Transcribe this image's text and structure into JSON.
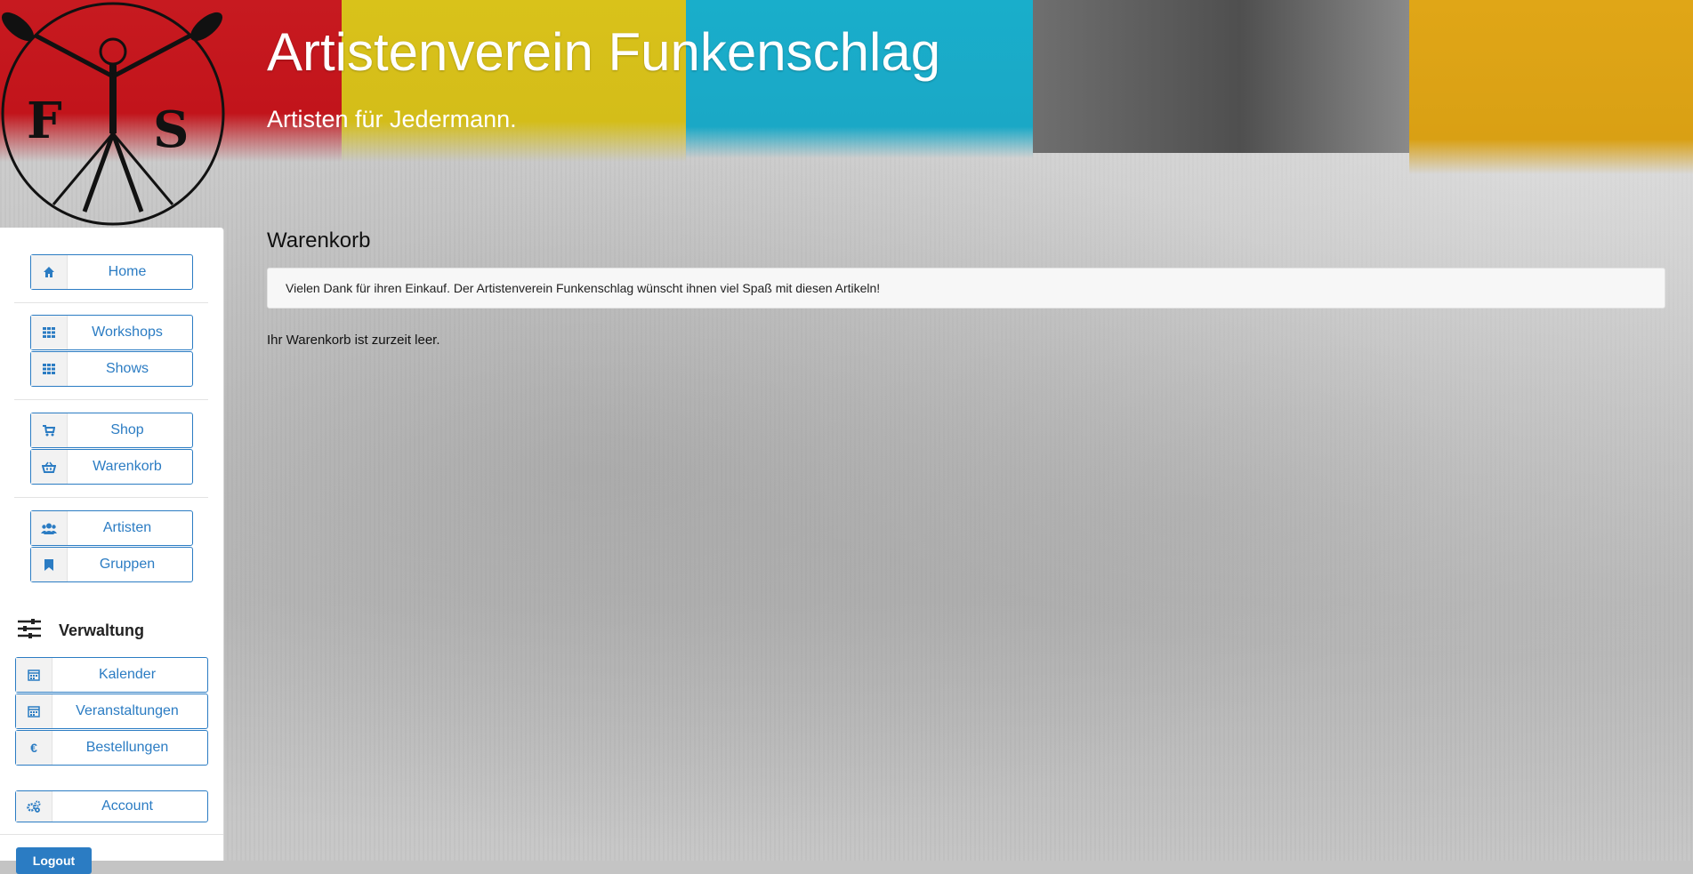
{
  "site": {
    "title": "Artistenverein Funkenschlag",
    "subtitle": "Artisten für Jedermann."
  },
  "colors": {
    "accent": "#2b7cc3",
    "banner_red": "#c71a20",
    "banner_yellow": "#d9c21a",
    "banner_cyan": "#19aecb",
    "banner_grey": "#5a5a5a",
    "banner_orange": "#e0a617"
  },
  "sidebar": {
    "items": [
      {
        "label": "Home",
        "icon": "home-icon"
      },
      {
        "label": "Workshops",
        "icon": "grid-icon"
      },
      {
        "label": "Shows",
        "icon": "grid-icon"
      },
      {
        "label": "Shop",
        "icon": "cart-icon"
      },
      {
        "label": "Warenkorb",
        "icon": "basket-icon"
      },
      {
        "label": "Artisten",
        "icon": "users-icon"
      },
      {
        "label": "Gruppen",
        "icon": "bookmark-icon"
      }
    ],
    "admin_heading": "Verwaltung",
    "admin_items": [
      {
        "label": "Kalender",
        "icon": "calendar-icon"
      },
      {
        "label": "Veranstaltungen",
        "icon": "calendar-icon"
      },
      {
        "label": "Bestellungen",
        "icon": "euro-icon"
      }
    ],
    "account_label": "Account",
    "logout_label": "Logout"
  },
  "main": {
    "title": "Warenkorb",
    "alert": "Vielen Dank für ihren Einkauf. Der Artistenverein Funkenschlag wünscht ihnen viel Spaß mit diesen Artikeln!",
    "empty_message": "Ihr Warenkorb ist zurzeit leer."
  }
}
